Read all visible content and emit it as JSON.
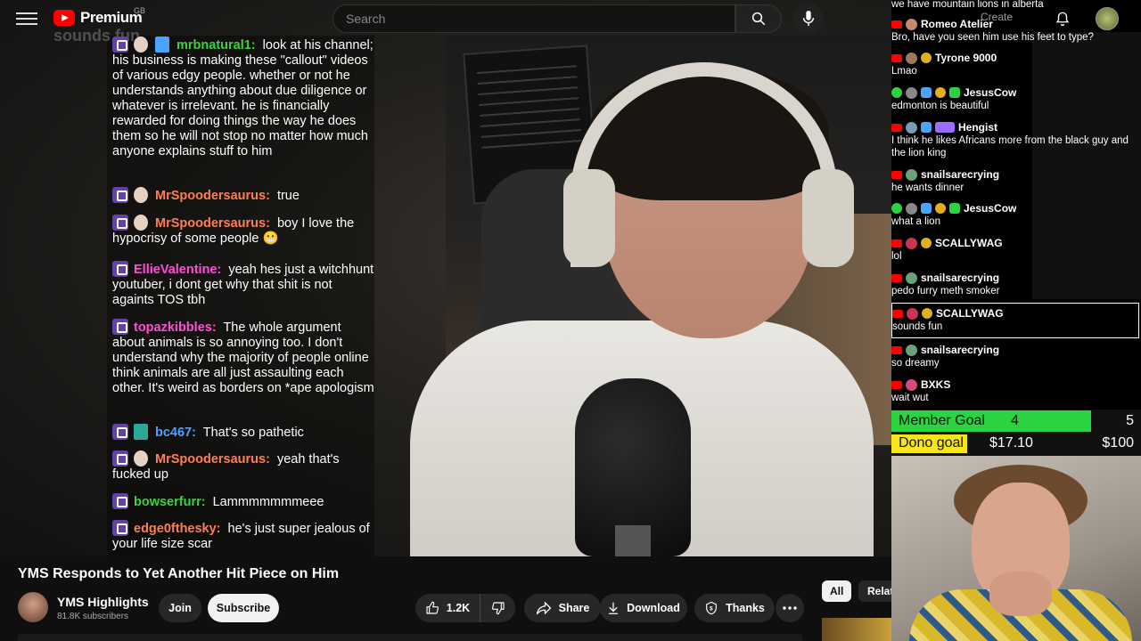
{
  "header": {
    "logo_text": "Premium",
    "logo_country": "GB",
    "search_placeholder": "Search",
    "create_label": "Create",
    "icons": [
      "menu-icon",
      "youtube-logo-icon",
      "search-icon",
      "microphone-icon",
      "bell-icon"
    ]
  },
  "video_overlay": {
    "streamer_tag": "sounds fun",
    "messages": [
      {
        "name": "mrbnatural1:",
        "color": "#3ed13e",
        "text": "look at his channel; his business is making these \"callout\" videos of various edgy people. whether or not he understands anything about due diligence or whatever is irrelevant. he is financially rewarded for doing things the way he does them so he will not stop no matter how much anyone explains stuff to him"
      },
      {
        "name": "MrSpoodersaurus:",
        "color": "#ff7f50",
        "text": "true"
      },
      {
        "name": "MrSpoodersaurus:",
        "color": "#ff7f50",
        "text": "boy I love the hypocrisy of some people 😬"
      },
      {
        "name": "EllieValentine:",
        "color": "#ff4fd8",
        "text": "yeah hes just a witchhunt youtuber, i dont get why that shit is not againts TOS tbh"
      },
      {
        "name": "topazkibbles:",
        "color": "#ff4fd8",
        "text": "The whole argument about animals is so annoying too. I don't understand why the majority of people online think animals are all just assaulting each other. It's weird as borders on *ape apologism"
      },
      {
        "name": "bc467:",
        "color": "#4aa3ff",
        "text": "That's so pathetic"
      },
      {
        "name": "MrSpoodersaurus:",
        "color": "#ff7f50",
        "text": "yeah that's fucked up"
      },
      {
        "name": "bowserfurr:",
        "color": "#3ed13e",
        "text": "Lammmmmmmeee"
      },
      {
        "name": "edge0fthesky:",
        "color": "#ff7f50",
        "text": "he's just super jealous of your life size scar"
      }
    ]
  },
  "right_chat": {
    "messages": [
      {
        "name": "",
        "text": "we have mountain lions in alberta"
      },
      {
        "name": "Romeo Atelier",
        "text": "Bro, have you seen him use his feet to type?"
      },
      {
        "name": "Tyrone 9000",
        "text": "Lmao"
      },
      {
        "name": "JesusCow",
        "text": "edmonton is beautiful"
      },
      {
        "name": "Hengist",
        "text": "I think he likes Africans more from the black guy and the lion king"
      },
      {
        "name": "snailsarecrying",
        "text": "he wants dinner"
      },
      {
        "name": "JesusCow",
        "text": "what a lion"
      },
      {
        "name": "SCALLYWAG",
        "text": "lol"
      },
      {
        "name": "snailsarecrying",
        "text": "pedo furry meth smoker"
      },
      {
        "name": "SCALLYWAG",
        "text": "sounds fun"
      },
      {
        "name": "snailsarecrying",
        "text": "so dreamy"
      },
      {
        "name": "BXKS",
        "text": "wait wut"
      }
    ]
  },
  "goals": {
    "member_label": "Member Goal",
    "member_current": "4",
    "member_target": "5",
    "member_progress": 0.8,
    "dono_label": "Dono goal",
    "dono_current": "$17.10",
    "dono_target": "$100",
    "dono_progress": 0.171
  },
  "info": {
    "title": "YMS Responds to Yet Another Hit Piece on Him",
    "channel_name": "YMS Highlights",
    "subscribers": "81.8K subscribers",
    "join_label": "Join",
    "subscribe_label": "Subscribe",
    "like_count": "1.2K",
    "share_label": "Share",
    "download_label": "Download",
    "thanks_label": "Thanks",
    "tab_all": "All",
    "tab_related": "Related"
  },
  "colors": {
    "youtube_red": "#ff0000",
    "member_goal_green": "#2ad33f",
    "dono_goal_yellow": "#f5e51a",
    "twitch_purple": "#6441a5"
  }
}
